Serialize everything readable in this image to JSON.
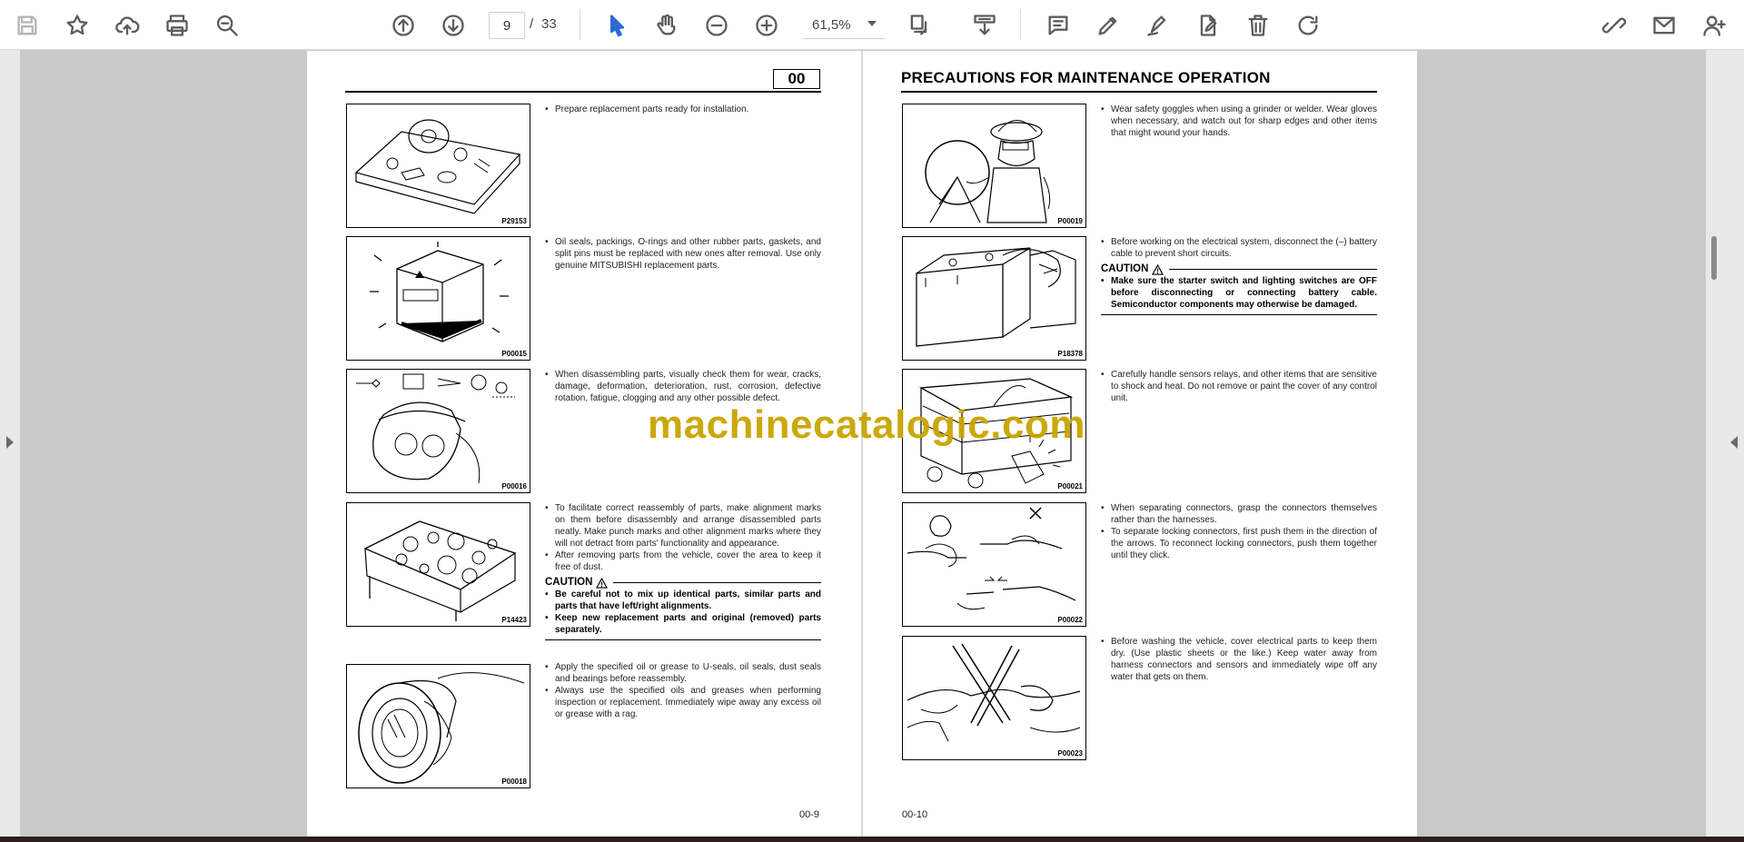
{
  "toolbar": {
    "icons": {
      "save": "save-icon",
      "bookmark": "star-icon",
      "upload": "cloud-upload-icon",
      "print": "print-icon",
      "zoom_search": "zoom-search-icon",
      "prev_page": "arrow-up-circle-icon",
      "next_page": "arrow-down-circle-icon",
      "select": "cursor-icon",
      "hand": "hand-icon",
      "zoom_out": "minus-circle-icon",
      "zoom_in": "plus-circle-icon",
      "fit": "fit-page-icon",
      "scroll_mode": "scroll-mode-icon",
      "comment": "comment-icon",
      "highlight": "pen-icon",
      "sign": "sign-icon",
      "edit": "edit-file-icon",
      "delete": "trash-icon",
      "rotate": "rotate-icon",
      "share": "share-icon",
      "email": "email-icon",
      "add_user": "add-user-icon"
    },
    "page_current": "9",
    "page_separator": "/",
    "page_total": "33",
    "zoom_level": "61,5%"
  },
  "left_page": {
    "section_number": "00",
    "page_number": "00-9",
    "items": [
      {
        "figure_code": "P29153",
        "bullets": [
          "Prepare replacement parts ready for installation."
        ]
      },
      {
        "figure_code": "P00015",
        "bullets": [
          "Oil seals, packings, O-rings and other rubber parts, gaskets, and split pins must be replaced with new ones after removal. Use only genuine MITSUBISHI replacement parts."
        ]
      },
      {
        "figure_code": "P00016",
        "bullets": [
          "When disassembling parts, visually check them for wear, cracks, damage, deformation, deterioration, rust, corrosion, defective rotation, fatigue, clogging and any other possible defect."
        ]
      },
      {
        "figure_code": "P14423",
        "bullets": [
          "To facilitate correct reassembly of parts, make alignment marks on them before disassembly and arrange disassembled parts neatly. Make punch marks and other alignment marks where they will not detract from parts' functionality and appearance.",
          "After removing parts from the vehicle, cover the area to keep it free of dust."
        ],
        "caution_label": "CAUTION",
        "caution_bullets": [
          "Be careful not to mix up identical parts, similar parts and parts that have left/right alignments.",
          "Keep new replacement parts and original (removed) parts separately."
        ]
      },
      {
        "figure_code": "P00018",
        "bullets": [
          "Apply the specified oil or grease to U-seals, oil seals, dust seals and bearings before reassembly.",
          "Always use the specified oils and greases when performing inspection or replacement. Immediately wipe away any excess oil or grease with a rag."
        ]
      }
    ]
  },
  "right_page": {
    "title": "PRECAUTIONS FOR MAINTENANCE OPERATION",
    "page_number": "00-10",
    "items": [
      {
        "figure_code": "P00019",
        "bullets": [
          "Wear safety goggles when using a grinder or welder. Wear gloves when necessary, and watch out for sharp edges and other items that might wound your hands."
        ]
      },
      {
        "figure_code": "P18378",
        "bullets": [
          "Before working on the electrical system, disconnect the (–) battery cable to prevent short circuits."
        ],
        "caution_label": "CAUTION",
        "caution_bullets": [
          "Make sure the starter switch and lighting switches are OFF before disconnecting or connecting battery cable. Semiconductor components may otherwise be damaged."
        ]
      },
      {
        "figure_code": "P00021",
        "bullets": [
          "Carefully handle sensors relays, and other items that are sensitive to shock and heat. Do not remove or paint the cover of any control unit."
        ]
      },
      {
        "figure_code": "P00022",
        "bullets": [
          "When separating connectors, grasp the connectors themselves rather than the harnesses.",
          "To separate locking connectors, first push them in the direction of the arrows. To reconnect locking connectors, push them together until they click."
        ]
      },
      {
        "figure_code": "P00023",
        "bullets": [
          "Before washing the vehicle, cover electrical parts to keep them dry. (Use plastic sheets or the like.) Keep water away from harness connectors and sensors and immediately wipe off any water that gets on them."
        ]
      }
    ]
  },
  "watermark": "machinecatalogic.com"
}
